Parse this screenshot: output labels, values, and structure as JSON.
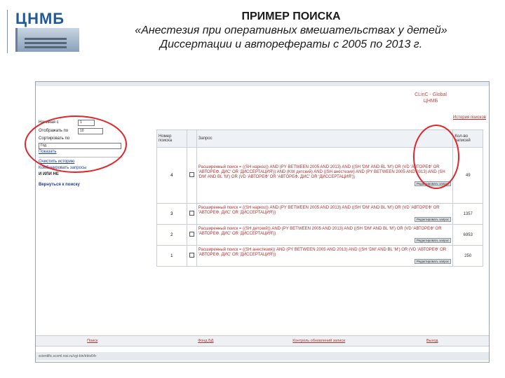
{
  "header": {
    "logo_text": "ЦНМБ",
    "title": "ПРИМЕР ПОИСКА",
    "subtitle": "«Анестезия при оперативных вмешательствах у детей»",
    "subtitle2": "Диссертации и авторефераты с 2005 по 2013 г."
  },
  "screen": {
    "brand": "CLinC - Global",
    "brand2": "ЦНМБ",
    "history_link": "История поисков",
    "left_panel": {
      "field1_label": "Начиная с",
      "field1_value": "1",
      "field2_label": "Отображать по",
      "field2_value": "10",
      "sort_label": "Сортировать по",
      "sort_value": "Год",
      "show_button": "Показать",
      "link1": "Очистить историю",
      "link2": "Комбинировать запросы",
      "link3": "И  ИЛИ  НЕ",
      "back_link": "Вернуться к поиску"
    },
    "table": {
      "col_num": "Номер поиска",
      "col_query": "Запрос",
      "col_count": "Кол-во записей",
      "edit_label": "Редактировать запрос",
      "rows": [
        {
          "num": "4",
          "query": "Расширенный поиск = ((SH наркоз)) AND (PY BETWEEN 2005 AND 2013) AND ((SH 'DM' AND BL 'M') OR (VD 'АВТОРЕФ' OR 'АВТОРЕФ. ДИС' OR 'ДИССЕРТАЦИЯ')) AND (KW детский) AND ((SH анестезия) AND (PY BETWEEN 2005 AND 2013) AND (SH 'DM' AND BL 'M') OR (VD 'АВТОРЕФ' OR 'АВТОРЕФ. ДИС' OR 'ДИССЕРТАЦИЯ'))",
          "count": "49"
        },
        {
          "num": "3",
          "query": "Расширенный поиск = ((SH наркоз)) AND (PY BETWEEN 2005 AND 2013) AND ((SH 'DM' AND BL 'M') OR (VD 'АВТОРЕФ' OR 'АВТОРЕФ. ДИС' OR 'ДИССЕРТАЦИЯ'))",
          "count": "1357"
        },
        {
          "num": "2",
          "query": "Расширенный поиск = ((SH детский)) AND (PY BETWEEN 2005 AND 2013) AND ((SH 'DM' AND BL 'M') OR (VD 'АВТОРЕФ' OR 'АВТОРЕФ. ДИС' OR 'ДИССЕРТАЦИЯ'))",
          "count": "6953"
        },
        {
          "num": "1",
          "query": "Расширенный поиск = ((SH анестезия)) AND (PY BETWEEN 2005 AND 2013) AND ((SH 'DM' AND BL 'M') OR (VD 'АВТОРЕФ' OR 'АВТОРЕФ. ДИС' OR 'ДИССЕРТАЦИЯ'))",
          "count": "250"
        }
      ]
    },
    "bottom": [
      "Поиск",
      "Фонд БД",
      "Контроль обновлений записи",
      "Выход"
    ],
    "status": "scientific.scsml.rssi.ru/cgi-bin/irbis64r"
  },
  "colors": {
    "annotation": "#e0262a",
    "query_text": "#b03030",
    "logo": "#1e5a9c"
  }
}
